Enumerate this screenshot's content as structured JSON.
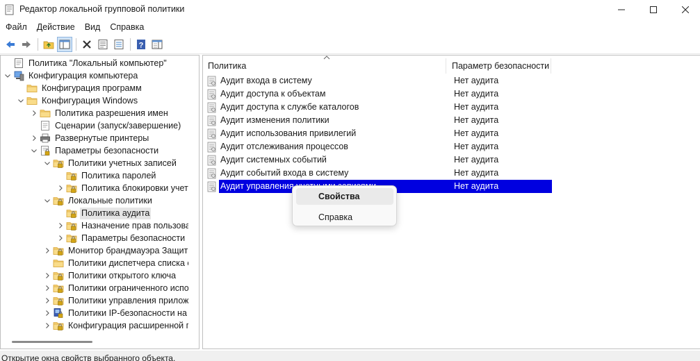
{
  "window": {
    "title": "Редактор локальной групповой политики"
  },
  "menu": [
    "Файл",
    "Действие",
    "Вид",
    "Справка"
  ],
  "toolbar": {
    "icons": [
      "back-icon",
      "forward-icon",
      "up-folder-icon",
      "show-hide-tree-icon",
      "delete-icon",
      "properties-icon",
      "export-icon",
      "help-icon",
      "show-pane-icon"
    ]
  },
  "tree": {
    "items": [
      {
        "label": "Политика \"Локальный компьютер\"",
        "icon": "policy-doc-icon"
      },
      {
        "label": "Конфигурация компьютера",
        "icon": "computer-icon"
      },
      {
        "label": "Конфигурация программ",
        "icon": "folder-icon"
      },
      {
        "label": "Конфигурация Windows",
        "icon": "folder-icon"
      },
      {
        "label": "Политика разрешения имен",
        "icon": "folder-icon"
      },
      {
        "label": "Сценарии (запуск/завершение)",
        "icon": "script-icon"
      },
      {
        "label": "Развернутые принтеры",
        "icon": "printer-icon"
      },
      {
        "label": "Параметры безопасности",
        "icon": "security-settings-icon"
      },
      {
        "label": "Политики учетных записей",
        "icon": "locked-folder-icon"
      },
      {
        "label": "Политика паролей",
        "icon": "locked-folder-icon"
      },
      {
        "label": "Политика блокировки учет",
        "icon": "locked-folder-icon"
      },
      {
        "label": "Локальные политики",
        "icon": "locked-folder-icon"
      },
      {
        "label": "Политика аудита",
        "icon": "locked-folder-icon"
      },
      {
        "label": "Назначение прав пользова",
        "icon": "locked-folder-icon"
      },
      {
        "label": "Параметры безопасности",
        "icon": "locked-folder-icon"
      },
      {
        "label": "Монитор брандмауэра Защит",
        "icon": "locked-folder-icon"
      },
      {
        "label": "Политики диспетчера списка с",
        "icon": "folder-icon"
      },
      {
        "label": "Политики открытого ключа",
        "icon": "locked-folder-icon"
      },
      {
        "label": "Политики ограниченного испо",
        "icon": "locked-folder-icon"
      },
      {
        "label": "Политики управления прилож",
        "icon": "locked-folder-icon"
      },
      {
        "label": "Политики IP-безопасности на",
        "icon": "ipsec-icon"
      },
      {
        "label": "Конфигурация расширенной г",
        "icon": "locked-folder-icon"
      }
    ]
  },
  "list": {
    "columns": [
      "Политика",
      "Параметр безопасности"
    ],
    "rows": [
      {
        "name": "Аудит входа в систему",
        "value": "Нет аудита"
      },
      {
        "name": "Аудит доступа к объектам",
        "value": "Нет аудита"
      },
      {
        "name": "Аудит доступа к службе каталогов",
        "value": "Нет аудита"
      },
      {
        "name": "Аудит изменения политики",
        "value": "Нет аудита"
      },
      {
        "name": "Аудит использования привилегий",
        "value": "Нет аудита"
      },
      {
        "name": "Аудит отслеживания процессов",
        "value": "Нет аудита"
      },
      {
        "name": "Аудит системных событий",
        "value": "Нет аудита"
      },
      {
        "name": "Аудит событий входа в систему",
        "value": "Нет аудита"
      },
      {
        "name": "Аудит управления учетными записями",
        "value": "Нет аудита"
      }
    ]
  },
  "context_menu": {
    "items": [
      "Свойства",
      "Справка"
    ]
  },
  "status": {
    "text": "Открытие окна свойств выбранного объекта."
  },
  "colors": {
    "selection": "#0000e0",
    "folder": "#f3c35b",
    "lock": "#c9a11a"
  }
}
